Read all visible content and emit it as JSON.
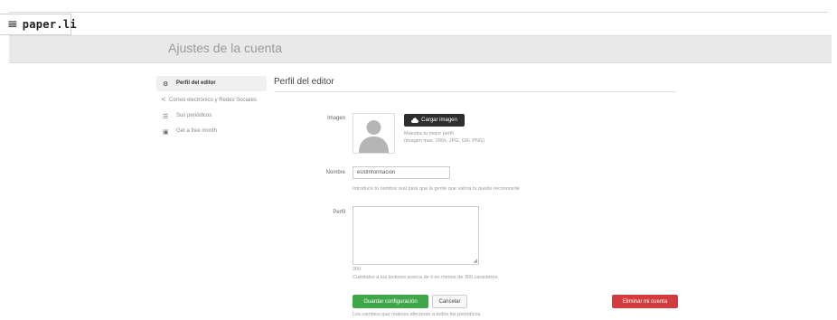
{
  "brand": {
    "logo": "paper.li",
    "menu_icon": "hamburger-icon"
  },
  "header": {
    "title": "Ajustes de la cuenta"
  },
  "sidebar": {
    "items": [
      {
        "label": "Perfil del editor",
        "icon": "gear-icon",
        "active": true
      },
      {
        "label": "Correo electrónico y Redes Sociales",
        "icon": "share-icon",
        "active": false
      },
      {
        "label": "Sus periódicos",
        "icon": "list-icon",
        "active": false
      },
      {
        "label": "Get a free month",
        "icon": "gift-icon",
        "active": false
      }
    ]
  },
  "section": {
    "title": "Perfil del editor"
  },
  "form": {
    "image": {
      "label": "Imagen",
      "upload_label": "Cargar imagen",
      "upload_icon": "cloud-upload-icon",
      "avatar_icon": "user-silhouette-icon",
      "hint_line1": "Muestra tu mejor perfil",
      "hint_line2": "(imagen max. 200x, JPG, GIF, PNG)"
    },
    "name": {
      "label": "Nombre",
      "value": "eUdInformacion",
      "hint": "Introduce tu nombre real para que la gente que valora tu puedo reconocerte"
    },
    "bio": {
      "label": "Perfil",
      "value": "",
      "counter": "300",
      "hint": "Cuéntales a tus lectores acerca de ti en menos de 300 caracteres."
    }
  },
  "actions": {
    "save_label": "Guardar configuración",
    "cancel_label": "Cancelar",
    "delete_label": "Eliminar mi cuenta",
    "footnote": "Los cambios que realices afectarán a todos los periódicos."
  },
  "colors": {
    "save_button": "#3fa74a",
    "delete_button": "#d23c3c",
    "upload_button": "#2e2e2e",
    "header_band": "#e9e9e9"
  }
}
